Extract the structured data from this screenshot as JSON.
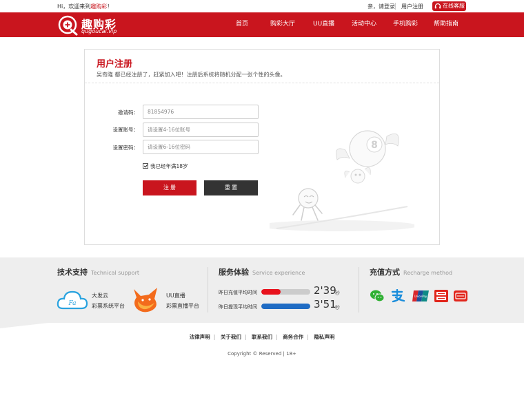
{
  "topbar": {
    "greeting_prefix": "Hi，欢迎来到",
    "brand": "趣购彩",
    "greeting_suffix": "！",
    "login_text": "亲，请登录",
    "register_text": "用户注册",
    "service_text": "在线客服"
  },
  "header": {
    "logo_name": "趣购彩",
    "logo_url": "qugoucai.vip",
    "nav": [
      "首页",
      "购彩大厅",
      "UU直播",
      "活动中心",
      "手机购彩",
      "帮助指南"
    ]
  },
  "register": {
    "title": "用户注册",
    "subtitle": "吴奇隆 都已经注册了，赶紧加入吧！注册后系统将随机分配一张个性的头像。",
    "invite_label": "邀请码：",
    "invite_value": "81854976",
    "account_label": "设置账号：",
    "account_placeholder": "请设置4-16位账号",
    "password_label": "设置密码：",
    "password_placeholder": "请设置6-16位密码",
    "age_text": "我已经年满18岁",
    "submit_label": "注 册",
    "reset_label": "重 置",
    "ball_number": "8"
  },
  "support": {
    "title": "技术支持",
    "title_en": "Technical support",
    "provider1_name": "大发云",
    "provider1_desc": "彩票系统平台",
    "provider2_name": "UU直播",
    "provider2_desc": "彩票直播平台"
  },
  "service": {
    "title": "服务体验",
    "title_en": "Service experience",
    "items": [
      {
        "label": "昨日充值平均时间",
        "value": "2'39",
        "unit": "秒",
        "fill": 0.4,
        "color": "#e8121d"
      },
      {
        "label": "昨日提现平均时间",
        "value": "3'51",
        "unit": "秒",
        "fill": 1.0,
        "color": "#1f6cc4"
      }
    ]
  },
  "recharge": {
    "title": "充值方式",
    "title_en": "Recharge method",
    "icons": [
      "wechat-pay-icon",
      "alipay-icon",
      "unionpay-icon",
      "jd-pay-icon",
      "bank-card-icon"
    ]
  },
  "footer": {
    "links": [
      "法律声明",
      "关于我们",
      "联系我们",
      "商务合作",
      "隐私声明"
    ],
    "copyright": "Copyright © Reserved | 18+"
  }
}
